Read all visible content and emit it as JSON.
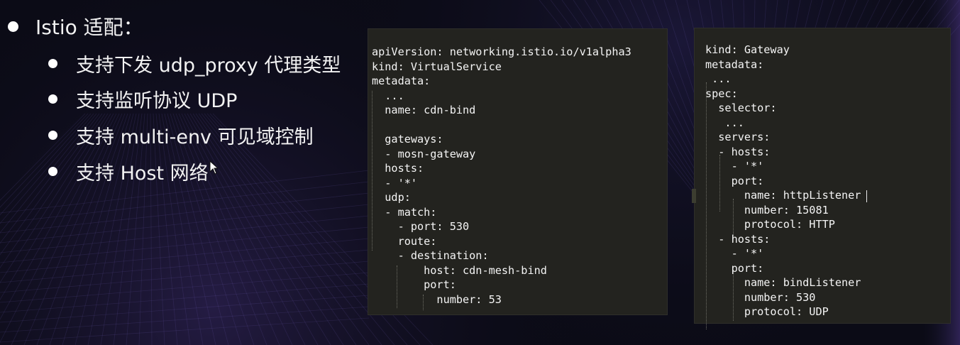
{
  "slide": {
    "heading": "Istio 适配：",
    "bullets": [
      "支持下发 udp_proxy 代理类型",
      "支持监听协议 UDP",
      "支持 multi-env 可见域控制",
      "支持 Host 网络"
    ]
  },
  "virtual_service_yaml": {
    "lines": [
      "apiVersion: networking.istio.io/v1alpha3",
      "kind: VirtualService",
      "metadata:",
      "  ...",
      "  name: cdn-bind",
      "",
      "  gateways:",
      "  - mosn-gateway",
      "  hosts:",
      "  - '*'",
      "  udp:",
      "  - match:",
      "    - port: 530",
      "    route:",
      "    - destination:",
      "        host: cdn-mesh-bind",
      "        port:",
      "          number: 53"
    ]
  },
  "gateway_yaml": {
    "lines": [
      "kind: Gateway",
      "metadata:",
      " ...",
      "spec:",
      "  selector:",
      "   ...",
      "  servers:",
      "  - hosts:",
      "    - '*'",
      "    port:",
      "      name: httpListener",
      "      number: 15081",
      "      protocol: HTTP",
      "  - hosts:",
      "    - '*'",
      "    port:",
      "      name: bindListener",
      "      number: 530",
      "      protocol: UDP"
    ]
  },
  "colors": {
    "background": "#0b0b16",
    "panel": "#23231f",
    "code_text": "#f4f4f4",
    "bullet_text": "#f2f2f2"
  }
}
